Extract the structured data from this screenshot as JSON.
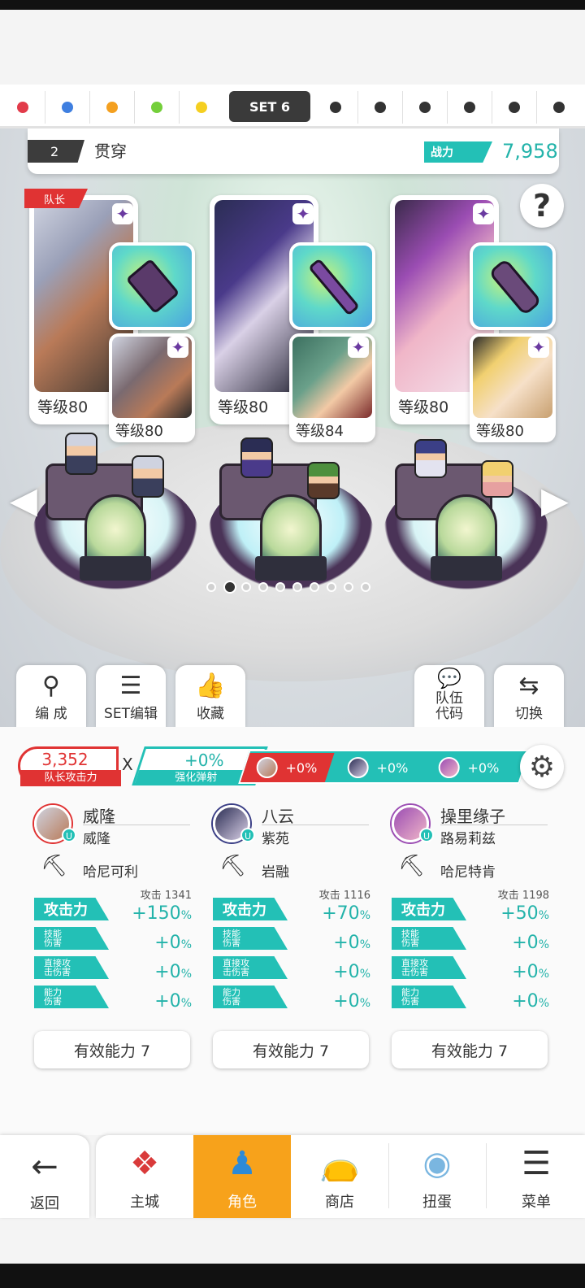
{
  "sets": {
    "colors": [
      "#e23b4a",
      "#3f7fe0",
      "#f4a020",
      "#74cf3a",
      "#f5cf20"
    ],
    "active_label": "SET 6",
    "empty_color": "#333333"
  },
  "team": {
    "number": "2",
    "name": "贯穿",
    "power_label": "战力",
    "power_value": "7,958"
  },
  "help_glyph": "?",
  "cards": [
    {
      "captain_label": "队长",
      "level": "等级80",
      "sub_level": "等级80"
    },
    {
      "level": "等级80",
      "sub_level": "等级84"
    },
    {
      "level": "等级80",
      "sub_level": "等级80"
    }
  ],
  "pager": {
    "count": 10,
    "active": 1
  },
  "actions": {
    "formation": "编 成",
    "set_edit": "SET编辑",
    "favorite": "收藏",
    "team_code": "队伍\n代码",
    "switch": "切换"
  },
  "bonus": {
    "leader_value": "3,352",
    "leader_label": "队长攻击力",
    "x": "X",
    "enhance_value": "+0%",
    "enhance_label": "强化弹射",
    "heroes": [
      "+0%",
      "+0%",
      "+0%"
    ]
  },
  "heroes": [
    {
      "name": "威隆",
      "sub": "威隆",
      "weapon": "哈尼可利",
      "atk_label": "攻击 1341",
      "atk_bonus": "+150",
      "skill": "+0",
      "direct": "+0",
      "ability": "+0",
      "effective": "有效能力 7"
    },
    {
      "name": "八云",
      "sub": "紫苑",
      "weapon": "岩融",
      "atk_label": "攻击 1116",
      "atk_bonus": "+70",
      "skill": "+0",
      "direct": "+0",
      "ability": "+0",
      "effective": "有效能力 7"
    },
    {
      "name": "操里缘子",
      "sub": "路易莉兹",
      "weapon": "哈尼特肯",
      "atk_label": "攻击 1198",
      "atk_bonus": "+50",
      "skill": "+0",
      "direct": "+0",
      "ability": "+0",
      "effective": "有效能力 7"
    }
  ],
  "stat_labels": {
    "attack": "攻击力",
    "skill": "技能\n伤害",
    "direct": "直接攻\n击伤害",
    "ability": "能力\n伤害",
    "percent": "%"
  },
  "nav": {
    "back": "返回",
    "castle": "主城",
    "character": "角色",
    "shop": "商店",
    "gacha": "扭蛋",
    "menu": "菜单"
  },
  "accent": "#23c0b6",
  "active_tab_color": "#f7a21b"
}
